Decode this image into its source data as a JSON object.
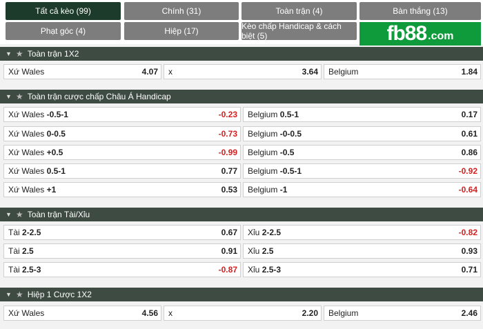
{
  "tabs": {
    "all": "Tất cả kèo (99)",
    "main": "Chính (31)",
    "full_match": "Toàn trận (4)",
    "goals": "Bàn thắng (13)",
    "corners": "Phạt góc (4)",
    "half": "Hiệp (17)",
    "handicap": "Kèo chấp Handicap & cách biệt (5)"
  },
  "logo": {
    "main": "fb88",
    "suffix": ".com"
  },
  "sections": {
    "s1": {
      "title": "Toàn trận 1X2",
      "cells": [
        {
          "name": "Xứ Wales",
          "odd": "4.07"
        },
        {
          "name": "x",
          "odd": "3.64"
        },
        {
          "name": "Belgium",
          "odd": "1.84"
        }
      ]
    },
    "s2": {
      "title": "Toàn trận cược chấp Châu Á Handicap",
      "rows": [
        {
          "home_name": "Xứ Wales",
          "home_line": "-0.5-1",
          "home_odd": "-0.23",
          "away_name": "Belgium",
          "away_line": "0.5-1",
          "away_odd": "0.17"
        },
        {
          "home_name": "Xứ Wales",
          "home_line": "0-0.5",
          "home_odd": "-0.73",
          "away_name": "Belgium",
          "away_line": "-0-0.5",
          "away_odd": "0.61"
        },
        {
          "home_name": "Xứ Wales",
          "home_line": "+0.5",
          "home_odd": "-0.99",
          "away_name": "Belgium",
          "away_line": "-0.5",
          "away_odd": "0.86"
        },
        {
          "home_name": "Xứ Wales",
          "home_line": "0.5-1",
          "home_odd": "0.77",
          "away_name": "Belgium",
          "away_line": "-0.5-1",
          "away_odd": "-0.92"
        },
        {
          "home_name": "Xứ Wales",
          "home_line": "+1",
          "home_odd": "0.53",
          "away_name": "Belgium",
          "away_line": "-1",
          "away_odd": "-0.64"
        }
      ]
    },
    "s3": {
      "title": "Toàn trận Tài/Xỉu",
      "rows": [
        {
          "over_name": "Tài",
          "over_line": "2-2.5",
          "over_odd": "0.67",
          "under_name": "Xỉu",
          "under_line": "2-2.5",
          "under_odd": "-0.82"
        },
        {
          "over_name": "Tài",
          "over_line": "2.5",
          "over_odd": "0.91",
          "under_name": "Xỉu",
          "under_line": "2.5",
          "under_odd": "0.93"
        },
        {
          "over_name": "Tài",
          "over_line": "2.5-3",
          "over_odd": "-0.87",
          "under_name": "Xỉu",
          "under_line": "2.5-3",
          "under_odd": "0.71"
        }
      ]
    },
    "s4": {
      "title": "Hiệp 1 Cược 1X2",
      "cells": [
        {
          "name": "Xứ Wales",
          "odd": "4.56"
        },
        {
          "name": "x",
          "odd": "2.20"
        },
        {
          "name": "Belgium",
          "odd": "2.46"
        }
      ]
    }
  },
  "colors": {
    "negative": "#d42020",
    "header_bg": "#3e4b42",
    "active_tab": "#1d3b2a",
    "tab": "#7d7d7d",
    "logo_bg": "#0f9b3b"
  }
}
